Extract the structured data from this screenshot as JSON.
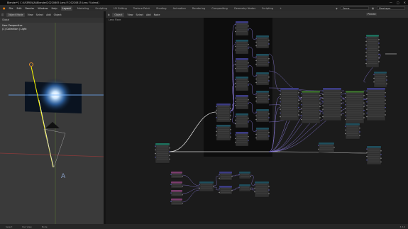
{
  "window": {
    "title": "Blender* [ C:\\USERS\\KAI\\Blender\\20220605 Lens Fl 20220815 Lens Fl.blend]",
    "minimize": "—",
    "maximize": "▢",
    "close": "✕"
  },
  "menu": {
    "items": [
      "File",
      "Edit",
      "Render",
      "Window",
      "Help"
    ],
    "workspaces": [
      "Layout",
      "Modeling",
      "Sculpting",
      "UV Editing",
      "Texture Paint",
      "Shading",
      "Animation",
      "Rendering",
      "Compositing",
      "Geometry Nodes",
      "Scripting"
    ],
    "active_workspace": "Layout",
    "scene": "Scene",
    "view_layer": "ViewLayer"
  },
  "viewport": {
    "mode": "Object Mode",
    "menus": [
      "View",
      "Select",
      "Add",
      "Object"
    ],
    "transform": "Global",
    "view_name": "User Perspective",
    "collection": "(1) Collection | Light"
  },
  "node_editor": {
    "type_button": "Object",
    "menus": [
      "View",
      "Select",
      "Add",
      "Node"
    ],
    "breadcrumb": "Lens Flare",
    "pinned": "Pinned",
    "colors": {
      "node_body": "#303030",
      "header_vector": "#3c3c83",
      "header_math": "#1f4e5c",
      "header_input": "#7a3d6d",
      "header_geo": "#1d6f5c",
      "header_group": "#3b6b2c",
      "wire": "#8a7ad8",
      "wire_white": "#e8e8e8",
      "socket_geo": "#00d6a3",
      "socket_float": "#a1a1a1",
      "socket_vector": "#6363c7",
      "frame": "#0d0d0d"
    }
  },
  "status": {
    "left": [
      "Select",
      "Pan View",
      "Node"
    ],
    "version": "3.3.0"
  }
}
